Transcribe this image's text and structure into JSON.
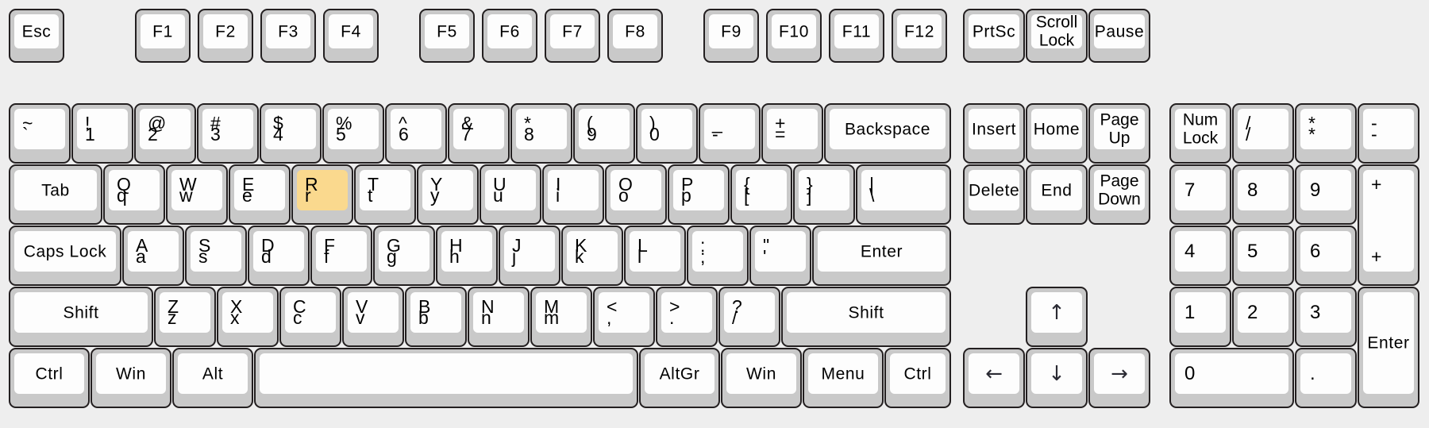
{
  "app": {
    "title": "Virtual Keyboard Layout",
    "background_color": "#eeeeee",
    "key_face_color": "#fdfdfd",
    "key_body_color": "#c9c9c9",
    "key_border_color": "#231f20",
    "highlight_color": "#fad98e",
    "highlighted_key": "R"
  },
  "keys": {
    "esc": {
      "label": "Esc"
    },
    "f1": {
      "label": "F1"
    },
    "f2": {
      "label": "F2"
    },
    "f3": {
      "label": "F3"
    },
    "f4": {
      "label": "F4"
    },
    "f5": {
      "label": "F5"
    },
    "f6": {
      "label": "F6"
    },
    "f7": {
      "label": "F7"
    },
    "f8": {
      "label": "F8"
    },
    "f9": {
      "label": "F9"
    },
    "f10": {
      "label": "F10"
    },
    "f11": {
      "label": "F11"
    },
    "f12": {
      "label": "F12"
    },
    "prtsc": {
      "label": "PrtSc"
    },
    "scrolllock": {
      "line1": "Scroll",
      "line2": "Lock"
    },
    "pause": {
      "label": "Pause"
    },
    "backtick": {
      "top": "~",
      "bottom": "`"
    },
    "d1": {
      "top": "!",
      "bottom": "1"
    },
    "d2": {
      "top": "@",
      "bottom": "2"
    },
    "d3": {
      "top": "#",
      "bottom": "3"
    },
    "d4": {
      "top": "$",
      "bottom": "4"
    },
    "d5": {
      "top": "%",
      "bottom": "5"
    },
    "d6": {
      "top": "^",
      "bottom": "6"
    },
    "d7": {
      "top": "&",
      "bottom": "7"
    },
    "d8": {
      "top": "*",
      "bottom": "8"
    },
    "d9": {
      "top": "(",
      "bottom": "9"
    },
    "d0": {
      "top": ")",
      "bottom": "0"
    },
    "minus": {
      "top": "_",
      "bottom": "-"
    },
    "equal": {
      "top": "+",
      "bottom": "="
    },
    "backspace": {
      "label": "Backspace"
    },
    "tab": {
      "label": "Tab"
    },
    "q": {
      "top": "Q",
      "bottom": "q"
    },
    "w": {
      "top": "W",
      "bottom": "w"
    },
    "e": {
      "top": "E",
      "bottom": "e"
    },
    "r": {
      "top": "R",
      "bottom": "r"
    },
    "t": {
      "top": "T",
      "bottom": "t"
    },
    "y": {
      "top": "Y",
      "bottom": "y"
    },
    "u": {
      "top": "U",
      "bottom": "u"
    },
    "i": {
      "top": "I",
      "bottom": "i"
    },
    "o": {
      "top": "O",
      "bottom": "o"
    },
    "p": {
      "top": "P",
      "bottom": "p"
    },
    "lbracket": {
      "top": "{",
      "bottom": "["
    },
    "rbracket": {
      "top": "}",
      "bottom": "]"
    },
    "backslash": {
      "top": "|",
      "bottom": "\\"
    },
    "capslock": {
      "label": "Caps Lock"
    },
    "a": {
      "top": "A",
      "bottom": "a"
    },
    "s": {
      "top": "S",
      "bottom": "s"
    },
    "d": {
      "top": "D",
      "bottom": "d"
    },
    "f": {
      "top": "F",
      "bottom": "f"
    },
    "g": {
      "top": "G",
      "bottom": "g"
    },
    "h": {
      "top": "H",
      "bottom": "h"
    },
    "j": {
      "top": "J",
      "bottom": "j"
    },
    "k": {
      "top": "K",
      "bottom": "k"
    },
    "l": {
      "top": "L",
      "bottom": "l"
    },
    "semicolon": {
      "top": ":",
      "bottom": ";"
    },
    "quote": {
      "top": "\"",
      "bottom": "'"
    },
    "enter": {
      "label": "Enter"
    },
    "lshift": {
      "label": "Shift"
    },
    "z": {
      "top": "Z",
      "bottom": "z"
    },
    "x": {
      "top": "X",
      "bottom": "x"
    },
    "c": {
      "top": "C",
      "bottom": "c"
    },
    "v": {
      "top": "V",
      "bottom": "v"
    },
    "b": {
      "top": "B",
      "bottom": "b"
    },
    "n": {
      "top": "N",
      "bottom": "n"
    },
    "m": {
      "top": "M",
      "bottom": "m"
    },
    "comma": {
      "top": "<",
      "bottom": ","
    },
    "period": {
      "top": ">",
      "bottom": "."
    },
    "slash": {
      "top": "?",
      "bottom": "/"
    },
    "rshift": {
      "label": "Shift"
    },
    "lctrl": {
      "label": "Ctrl"
    },
    "lwin": {
      "label": "Win"
    },
    "lalt": {
      "label": "Alt"
    },
    "space": {
      "label": ""
    },
    "altgr": {
      "label": "AltGr"
    },
    "rwin": {
      "label": "Win"
    },
    "menu": {
      "label": "Menu"
    },
    "rctrl": {
      "label": "Ctrl"
    },
    "insert": {
      "label": "Insert"
    },
    "home": {
      "label": "Home"
    },
    "pageup": {
      "line1": "Page",
      "line2": "Up"
    },
    "delete": {
      "label": "Delete"
    },
    "end": {
      "label": "End"
    },
    "pagedown": {
      "line1": "Page",
      "line2": "Down"
    },
    "arrowup": {
      "label": "↑"
    },
    "arrowleft": {
      "label": "←"
    },
    "arrowdown": {
      "label": "↓"
    },
    "arrowright": {
      "label": "→"
    },
    "numlock": {
      "line1": "Num",
      "line2": "Lock"
    },
    "numdivide": {
      "top": "/",
      "bottom": "/"
    },
    "nummultiply": {
      "top": "*",
      "bottom": "*"
    },
    "numminus": {
      "top": "-",
      "bottom": "-"
    },
    "num7": {
      "label": "7"
    },
    "num8": {
      "label": "8"
    },
    "num9": {
      "label": "9"
    },
    "numplus": {
      "top": "+",
      "bottom": "+"
    },
    "num4": {
      "label": "4"
    },
    "num5": {
      "label": "5"
    },
    "num6": {
      "label": "6"
    },
    "num1": {
      "label": "1"
    },
    "num2": {
      "label": "2"
    },
    "num3": {
      "label": "3"
    },
    "numenter": {
      "label": "Enter"
    },
    "num0": {
      "label": "0"
    },
    "numperiod": {
      "label": "."
    }
  }
}
